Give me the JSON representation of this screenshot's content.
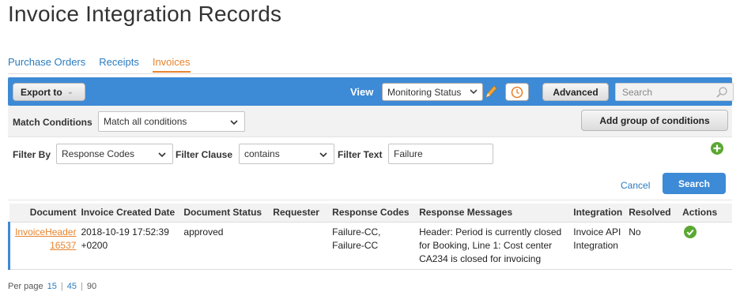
{
  "page": {
    "title": "Invoice Integration Records"
  },
  "tabs": [
    {
      "label": "Purchase Orders",
      "active": false
    },
    {
      "label": "Receipts",
      "active": false
    },
    {
      "label": "Invoices",
      "active": true
    }
  ],
  "toolbar": {
    "export_label": "Export to",
    "view_label": "View",
    "view_value": "Monitoring Status",
    "advanced_label": "Advanced",
    "search_placeholder": "Search"
  },
  "match": {
    "label": "Match Conditions",
    "value": "Match all conditions",
    "add_group_label": "Add group of conditions"
  },
  "filter": {
    "by_label": "Filter By",
    "by_value": "Response Codes",
    "clause_label": "Filter Clause",
    "clause_value": "contains",
    "text_label": "Filter Text",
    "text_value": "Failure",
    "cancel_label": "Cancel",
    "search_label": "Search"
  },
  "table": {
    "headers": [
      "Document",
      "Invoice Created Date",
      "Document Status",
      "Requester",
      "Response Codes",
      "Response Messages",
      "Integration",
      "Resolved",
      "Actions"
    ],
    "rows": [
      {
        "document_line1": "InvoiceHeader",
        "document_line2": "16537",
        "created_line1": "2018-10-19 17:52:39",
        "created_line2": "+0200",
        "status": "approved",
        "requester": "",
        "codes_line1": "Failure-CC,",
        "codes_line2": "Failure-CC",
        "msg_line1": "Header: Period is currently closed",
        "msg_line2": "for Booking, Line 1: Cost center",
        "msg_line3": "CA234 is closed for invoicing",
        "integration_line1": "Invoice API",
        "integration_line2": "Integration",
        "resolved": "No",
        "action_icon": "check-circle-icon"
      }
    ]
  },
  "pager": {
    "label": "Per page",
    "options": [
      "15",
      "45",
      "90"
    ]
  },
  "colors": {
    "accent_blue": "#3d8ad6",
    "orange": "#e8842e",
    "green": "#5aa832"
  }
}
